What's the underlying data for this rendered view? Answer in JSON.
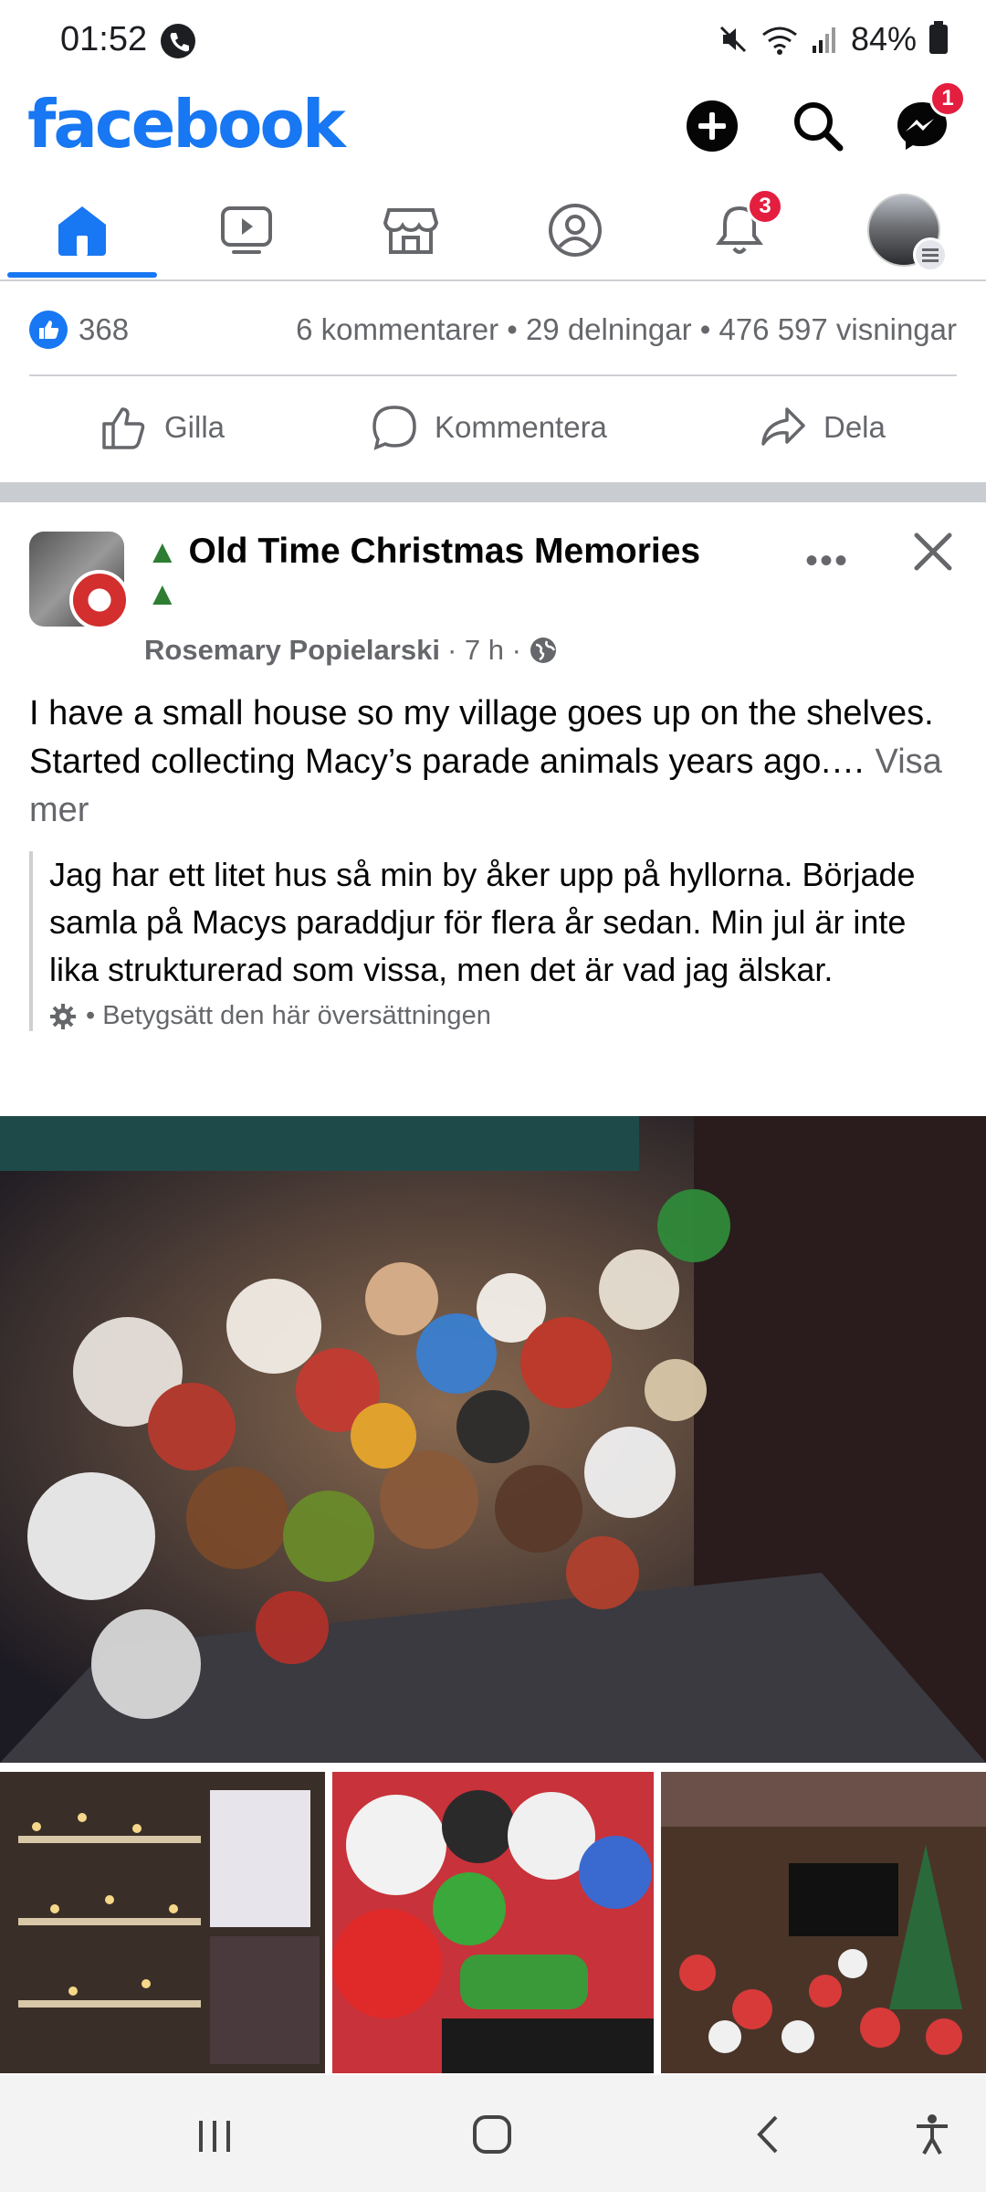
{
  "status_bar": {
    "time": "01:52",
    "battery": "84%"
  },
  "header": {
    "logo": "facebook",
    "messenger_badge": "1"
  },
  "tabs": {
    "notifications_badge": "3"
  },
  "stats": {
    "likes": "368",
    "summary": "6 kommentarer • 29 delningar • 476 597 visningar"
  },
  "actions": {
    "like_label": "Gilla",
    "comment_label": "Kommentera",
    "share_label": "Dela"
  },
  "post": {
    "group_name": "Old Time Christmas Memories",
    "author": "Rosemary Popielarski",
    "time": "· 7 h ·",
    "text": "I have a small house so my village goes up on the shelves. Started collecting Macy’s parade animals years ago.… ",
    "see_more": "Visa mer",
    "translation": "Jag har ett litet hus så min by åker upp på hyllorna. Började samla på Macys paraddjur för flera år sedan. Min jul är inte lika strukturerad som vissa, men det är vad jag älskar.",
    "rate_translation": "• Betygsätt den här översättningen"
  },
  "colors": {
    "brand": "#1877f2",
    "badge": "#e41e3f",
    "secondary_text": "#65676b"
  },
  "icons": {
    "header": [
      "add-icon",
      "search-icon",
      "messenger-icon"
    ],
    "tabs": [
      "home-icon",
      "video-icon",
      "marketplace-icon",
      "profile-icon",
      "bell-icon",
      "avatar"
    ],
    "nav": [
      "recent-apps-icon",
      "home-nav-icon",
      "back-icon",
      "accessibility-icon"
    ]
  }
}
